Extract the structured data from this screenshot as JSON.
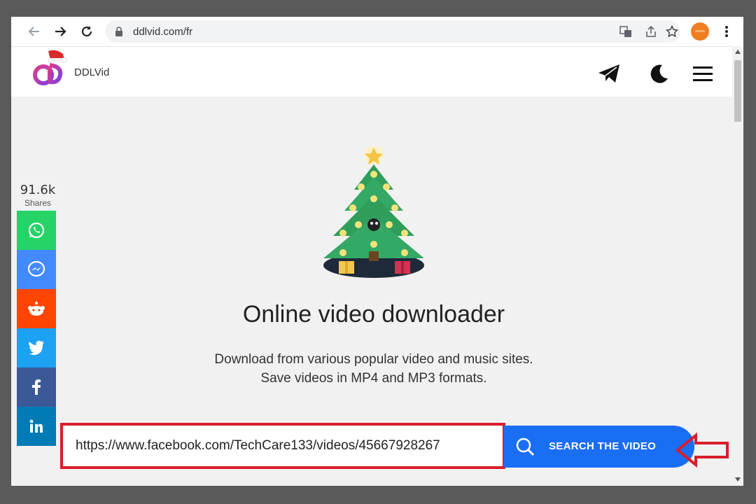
{
  "browser": {
    "url": "ddlvid.com/fr",
    "icons": [
      "back-icon",
      "forward-icon",
      "reload-icon",
      "lock-icon",
      "translate-icon",
      "share-icon",
      "star-icon",
      "profile-avatar",
      "menu-icon"
    ]
  },
  "site": {
    "brand": "DDLVid",
    "header_icons": [
      "telegram-icon",
      "dark-mode-icon",
      "hamburger-menu-icon"
    ]
  },
  "share": {
    "count": "91.6k",
    "label": "Shares",
    "buttons": [
      {
        "name": "whatsapp",
        "color": "#25d366"
      },
      {
        "name": "messenger",
        "color": "#448aff"
      },
      {
        "name": "reddit",
        "color": "#ff4500"
      },
      {
        "name": "twitter",
        "color": "#1da1f2"
      },
      {
        "name": "facebook",
        "color": "#3b5998"
      },
      {
        "name": "linkedin",
        "color": "#007bb5"
      }
    ]
  },
  "main": {
    "title": "Online video downloader",
    "subtitle_line1": "Download from various popular video and music sites.",
    "subtitle_line2": "Save videos in MP4 and MP3 formats."
  },
  "search": {
    "input_value": "https://www.facebook.com/TechCare133/videos/45667928267",
    "button_label": "SEARCH THE VIDEO"
  },
  "colors": {
    "accent": "#1a6ef4",
    "highlight": "#d81e2c"
  }
}
